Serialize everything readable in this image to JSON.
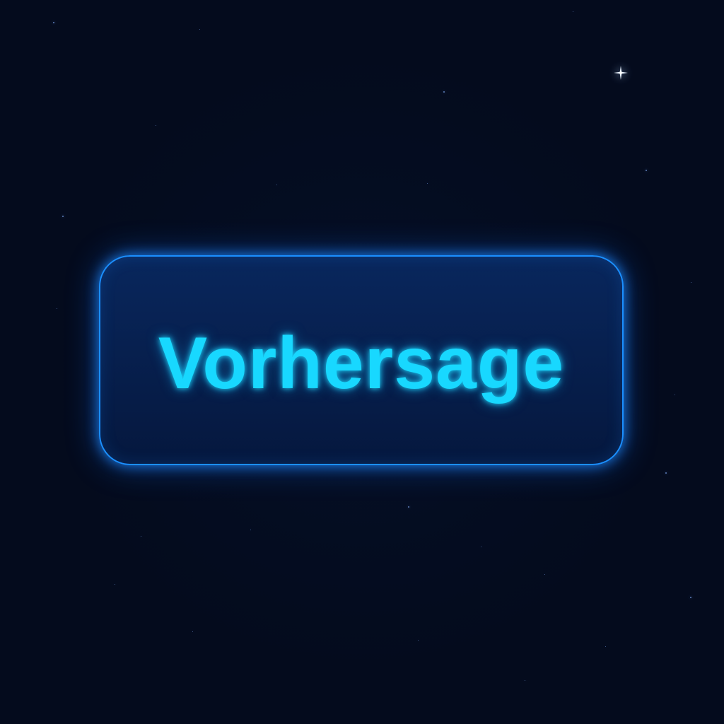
{
  "main": {
    "button_label": "Vorhersage"
  },
  "colors": {
    "background": "#040b1d",
    "button_border": "#1b8fff",
    "button_fill": "#0b2a62",
    "label": "#18d8ff"
  },
  "icons": {
    "sparkle": "sparkle-star-icon"
  }
}
